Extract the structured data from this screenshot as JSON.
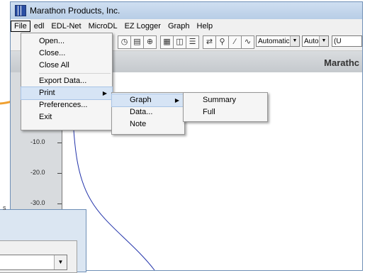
{
  "window": {
    "title": "Marathon Products, Inc."
  },
  "menubar": [
    "File",
    "edl",
    "EDL-Net",
    "MicroDL",
    "EZ Logger",
    "Graph",
    "Help"
  ],
  "toolbar": {
    "dropdowns": [
      "Automatic",
      "Auto",
      "(U"
    ]
  },
  "header": {
    "company_label": "Marathc"
  },
  "file_menu": [
    {
      "label": "Open..."
    },
    {
      "label": "Close..."
    },
    {
      "label": "Close All"
    },
    {
      "label": "Export Data..."
    },
    {
      "label": "Print",
      "submenu": true
    },
    {
      "label": "Preferences..."
    },
    {
      "label": "Exit"
    }
  ],
  "print_submenu": [
    {
      "label": "Graph",
      "submenu": true
    },
    {
      "label": "Data..."
    },
    {
      "label": "Note"
    }
  ],
  "graph_submenu": [
    {
      "label": "Summary"
    },
    {
      "label": "Full"
    }
  ],
  "y_axis": {
    "ticks": [
      "-10.0",
      "-20.0",
      "-30.0"
    ],
    "unit_fragment": "s"
  },
  "colors": {
    "accent": "#f0a030",
    "curve": "#2233aa",
    "menu_highlight": "#d6e4f5"
  }
}
